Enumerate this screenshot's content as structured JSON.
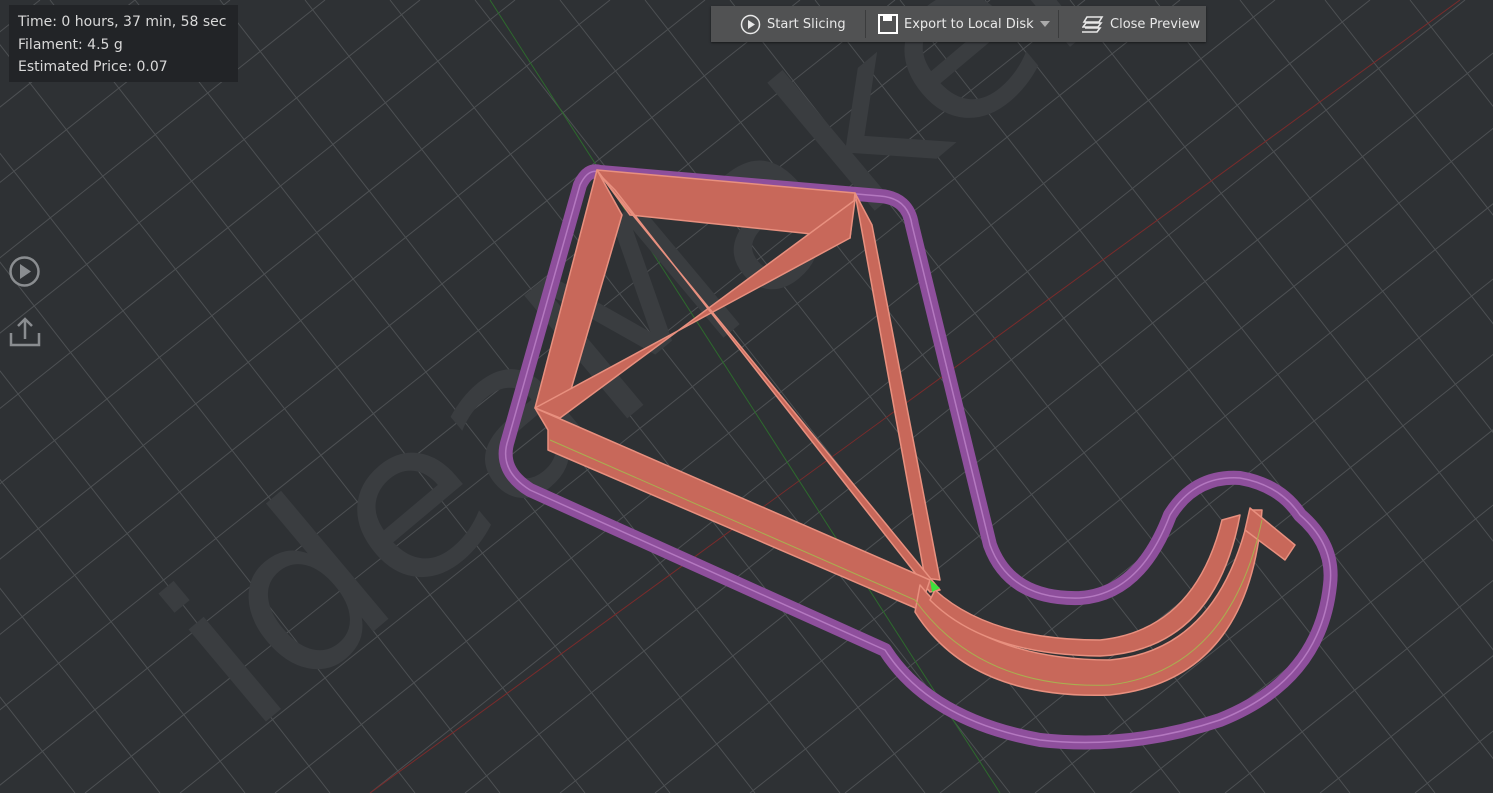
{
  "stats": {
    "time": "Time: 0 hours, 37 min, 58 sec",
    "filament": "Filament: 4.5 g",
    "price": "Estimated Price: 0.07"
  },
  "toolbar": {
    "start_slicing": "Start Slicing",
    "export": "Export to Local Disk",
    "close_preview": "Close Preview"
  },
  "watermark": "ideaMaker",
  "colors": {
    "background": "#2e3134",
    "outer_wall": "#e07a6a",
    "skirt": "#9a5aa8",
    "grid": "#55585b",
    "x_axis": "#8a2a2a",
    "y_axis": "#2a7a2a"
  }
}
